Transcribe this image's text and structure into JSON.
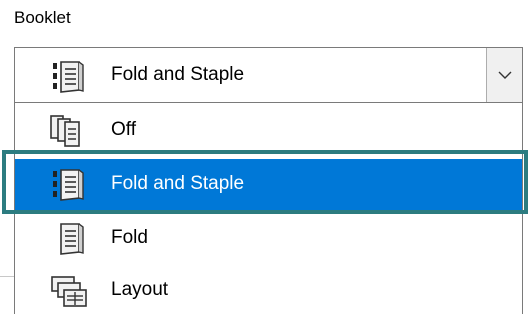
{
  "booklet": {
    "label": "Booklet",
    "selected": {
      "label": "Fold and Staple",
      "icon": "fold-staple-icon"
    },
    "options": [
      {
        "label": "Off",
        "icon": "booklet-off-icon"
      },
      {
        "label": "Fold and Staple",
        "icon": "fold-staple-icon",
        "selected": true
      },
      {
        "label": "Fold",
        "icon": "fold-icon"
      },
      {
        "label": "Layout",
        "icon": "layout-icon"
      }
    ]
  },
  "colors": {
    "selection": "#0078d7",
    "highlight_outline": "#2c7c80"
  }
}
